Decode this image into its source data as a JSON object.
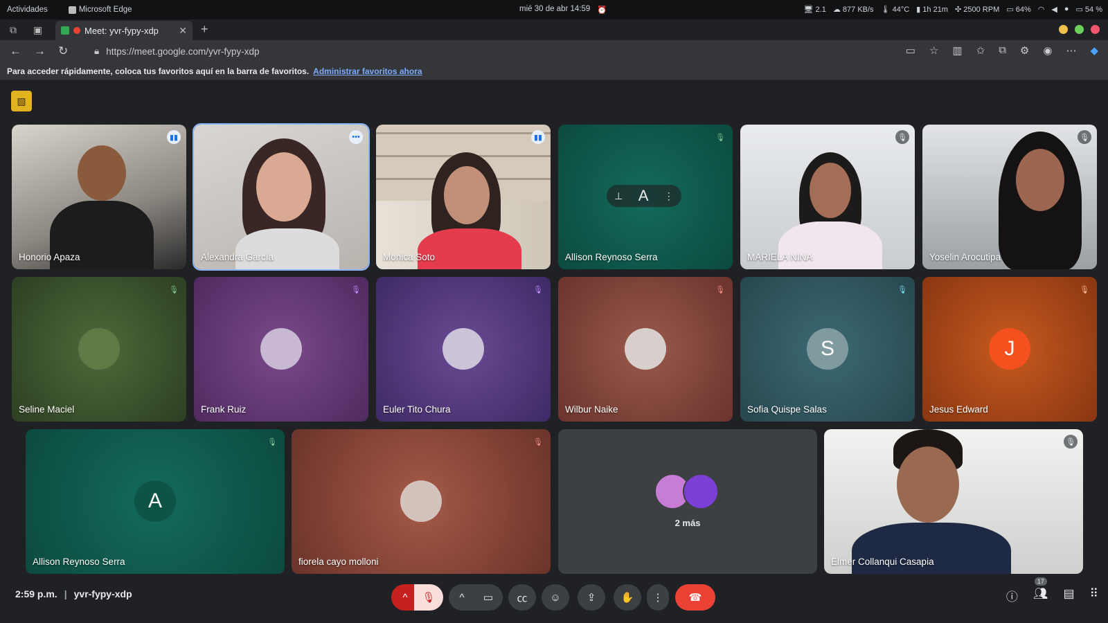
{
  "os_bar": {
    "activities": "Actividades",
    "app": "Microsoft Edge",
    "datetime": "mié 30 de abr  14:59",
    "cpu": "2.1",
    "net": "877 KB/s",
    "temp": "44°C",
    "uptime": "1h 21m",
    "fan": "2500 RPM",
    "mem": "64%",
    "battery": "54 %"
  },
  "browser": {
    "tab_title": "Meet: yvr-fypy-xdp",
    "url_host": "https://meet.google.com",
    "url_path": "/yvr-fypy-xdp",
    "fav_hint": "Para acceder rápidamente, coloca tus favoritos aquí en la barra de favoritos.",
    "fav_link": "Administrar favoritos ahora"
  },
  "participants": [
    {
      "name": "Honorio Apaza",
      "status": "speaking"
    },
    {
      "name": "Alexandra García",
      "status": "more"
    },
    {
      "name": "Monica Soto",
      "status": "speaking"
    },
    {
      "name": "Allison Reynoso Serra",
      "status": "muted",
      "initial": "A"
    },
    {
      "name": "MARIELA NINA",
      "status": "muted"
    },
    {
      "name": "Yoselin Arocutipa",
      "status": "muted"
    },
    {
      "name": "Seline Maciel",
      "status": "muted"
    },
    {
      "name": "Frank Ruiz",
      "status": "muted"
    },
    {
      "name": "Euler Tito Chura",
      "status": "muted"
    },
    {
      "name": "Wilbur Naike",
      "status": "muted"
    },
    {
      "name": "Sofia Quispe Salas",
      "status": "muted",
      "initial": "S"
    },
    {
      "name": "Jesus Edward",
      "status": "muted",
      "initial": "J"
    },
    {
      "name": "Allison Reynoso Serra",
      "status": "muted",
      "initial": "A"
    },
    {
      "name": "fiorela cayo molloni",
      "status": "muted"
    },
    {
      "name": "Elmer Collanqui Casapia",
      "status": "muted"
    }
  ],
  "more_tile": {
    "label": "2 más"
  },
  "meeting": {
    "time": "2:59 p.m.",
    "code": "yvr-fypy-xdp",
    "people_count": "17"
  },
  "colors": {
    "end_call": "#ea4335",
    "mic_off": "#f9dedc",
    "accent": "#8ab4f8"
  }
}
